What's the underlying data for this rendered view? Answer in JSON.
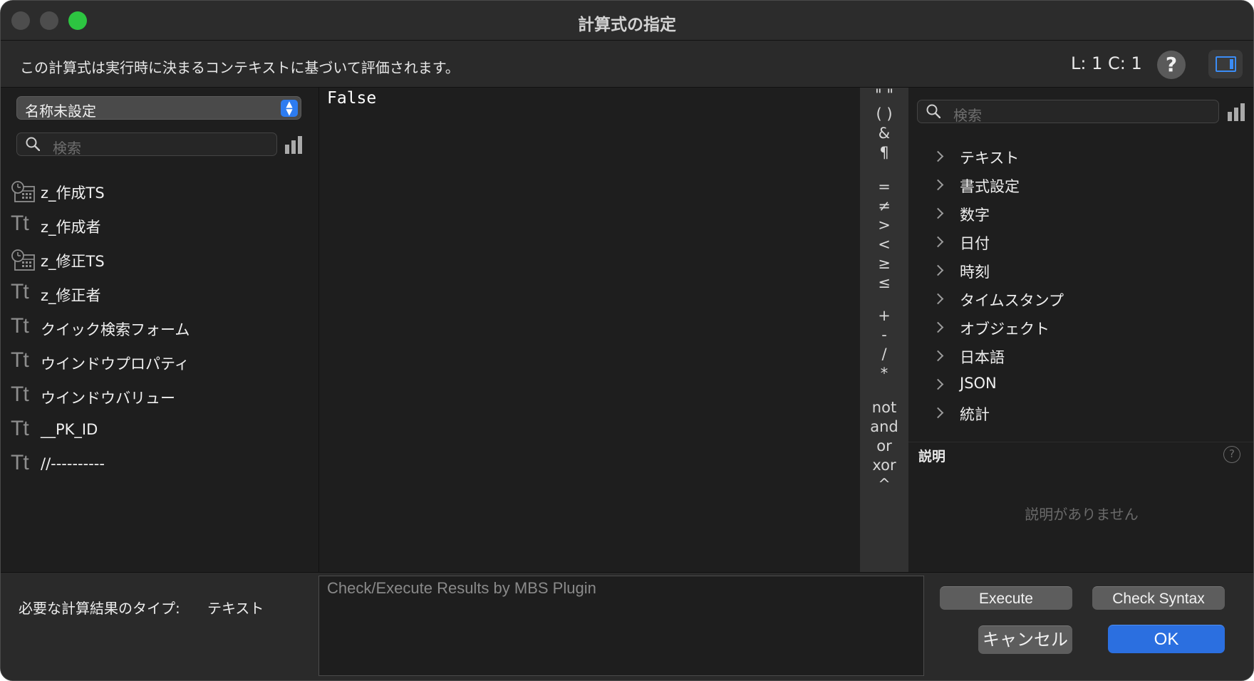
{
  "window": {
    "title": "計算式の指定"
  },
  "infobar": {
    "message": "この計算式は実行時に決まるコンテキストに基づいて評価されます。",
    "cursor_position": "L: 1 C: 1",
    "help_label": "?"
  },
  "left_panel": {
    "table_select": {
      "value": "名称未設定",
      "stepper": "⌃⌄"
    },
    "search": {
      "placeholder": "検索"
    },
    "fields": [
      {
        "icon": "timestamp-icon",
        "name": "z_作成TS"
      },
      {
        "icon": "text-field-icon",
        "name": "z_作成者"
      },
      {
        "icon": "timestamp-icon",
        "name": "z_修正TS"
      },
      {
        "icon": "text-field-icon",
        "name": "z_修正者"
      },
      {
        "icon": "text-field-icon",
        "name": "クイック検索フォーム"
      },
      {
        "icon": "text-field-icon",
        "name": "ウインドウプロパティ"
      },
      {
        "icon": "text-field-icon",
        "name": "ウインドウバリュー"
      },
      {
        "icon": "text-field-icon",
        "name": "__PK_ID"
      },
      {
        "icon": "text-field-icon",
        "name": "//----------"
      }
    ],
    "text_icon_glyph": "Tt"
  },
  "editor": {
    "content": "False"
  },
  "operators": [
    "\" \"",
    "( )",
    "&",
    "¶",
    "=",
    "≠",
    ">",
    "<",
    "≥",
    "≤",
    "+",
    "-",
    "/",
    "*",
    "not",
    "and",
    "or",
    "xor",
    "^"
  ],
  "right_panel": {
    "search": {
      "placeholder": "検索"
    },
    "categories": [
      "テキスト",
      "書式設定",
      "数字",
      "日付",
      "時刻",
      "タイムスタンプ",
      "オブジェクト",
      "日本語",
      "JSON",
      "統計"
    ],
    "description": {
      "title": "説明",
      "help_label": "?",
      "empty_text": "説明がありません"
    }
  },
  "bottom": {
    "result_type_label": "必要な計算結果のタイプ:",
    "result_type_value": "テキスト",
    "results_placeholder": "Check/Execute Results by MBS Plugin",
    "buttons": {
      "execute": "Execute",
      "check_syntax": "Check Syntax",
      "cancel": "キャンセル",
      "ok": "OK"
    }
  },
  "colors": {
    "accent": "#2b6fe0",
    "zoom_green": "#2dc541",
    "background": "#1e1e1e"
  }
}
